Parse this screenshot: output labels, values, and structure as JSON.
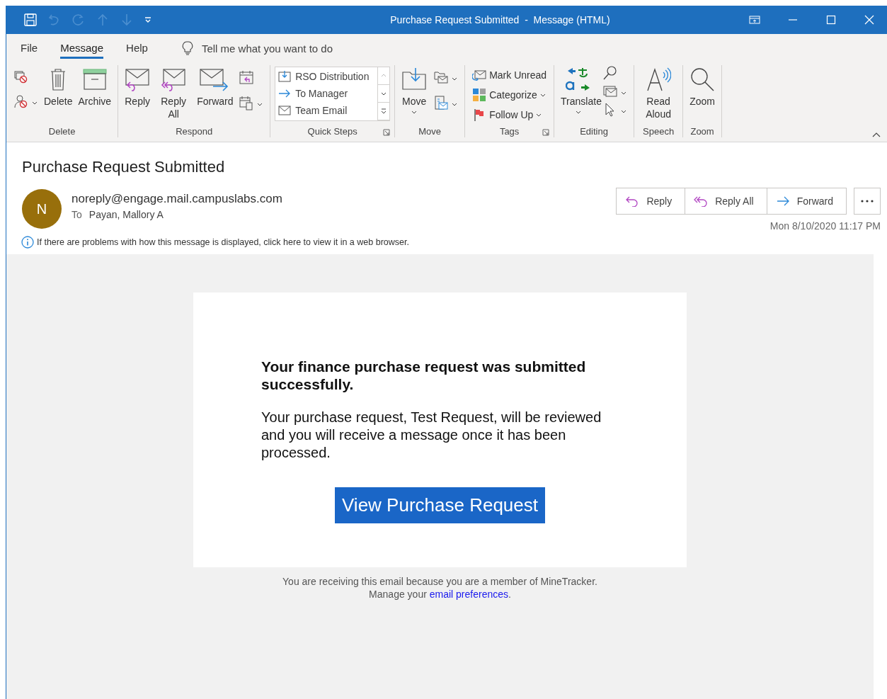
{
  "window": {
    "title": "Purchase Request Submitted  -  Message (HTML)"
  },
  "tabs": [
    {
      "label": "File",
      "selected": false
    },
    {
      "label": "Message",
      "selected": true
    },
    {
      "label": "Help",
      "selected": false
    }
  ],
  "tell_me": {
    "placeholder": "Tell me what you want to do"
  },
  "groups": [
    {
      "label": "Delete",
      "launcher": false,
      "buttons": [
        {
          "kind": "large",
          "label": "Delete",
          "caret": false
        },
        {
          "kind": "large",
          "label": "Archive",
          "caret": false
        }
      ]
    },
    {
      "label": "Respond",
      "launcher": false,
      "buttons": [
        {
          "kind": "large",
          "label": "Reply",
          "caret": false
        },
        {
          "kind": "large",
          "label": "Reply All",
          "caret": false
        },
        {
          "kind": "large",
          "label": "Forward",
          "caret": false
        }
      ]
    },
    {
      "label": "Quick Steps",
      "launcher": true,
      "quick_steps": [
        "RSO Distribution",
        "To Manager",
        "Team Email"
      ]
    },
    {
      "label": "Move",
      "launcher": false,
      "buttons": [
        {
          "kind": "large",
          "label": "Move",
          "caret": true
        }
      ]
    },
    {
      "label": "Tags",
      "launcher": true,
      "buttons": [
        {
          "kind": "row",
          "label": "Mark Unread",
          "caret": false
        },
        {
          "kind": "row",
          "label": "Categorize",
          "caret": true
        },
        {
          "kind": "row",
          "label": "Follow Up",
          "caret": true
        }
      ]
    },
    {
      "label": "Editing",
      "launcher": false,
      "buttons": [
        {
          "kind": "large",
          "label": "Translate",
          "caret": true
        }
      ]
    },
    {
      "label": "Speech",
      "launcher": false,
      "buttons": [
        {
          "kind": "large",
          "label": "Read Aloud",
          "caret": false
        }
      ]
    },
    {
      "label": "Zoom",
      "launcher": false,
      "buttons": [
        {
          "kind": "large",
          "label": "Zoom",
          "caret": false
        }
      ]
    }
  ],
  "message": {
    "subject": "Purchase Request Submitted",
    "sender": {
      "initial": "N",
      "address": "noreply@engage.mail.campuslabs.com",
      "to_label": "To",
      "to": "Payan, Mallory A"
    },
    "actions": [
      "Reply",
      "Reply All",
      "Forward"
    ],
    "date": "Mon 8/10/2020 11:17 PM",
    "info": "If there are problems with how this message is displayed, click here to view it in a web browser."
  },
  "email": {
    "heading": "Your finance purchase request was submitted successfully.",
    "body": "Your purchase request, Test Request, will be reviewed and you will receive a message once it has been processed.",
    "button": "View Purchase Request",
    "footer": "You are receiving this email because you are a member of MineTracker.",
    "manage": {
      "before": "Manage your",
      "link": "email preferences",
      "after": "."
    }
  }
}
